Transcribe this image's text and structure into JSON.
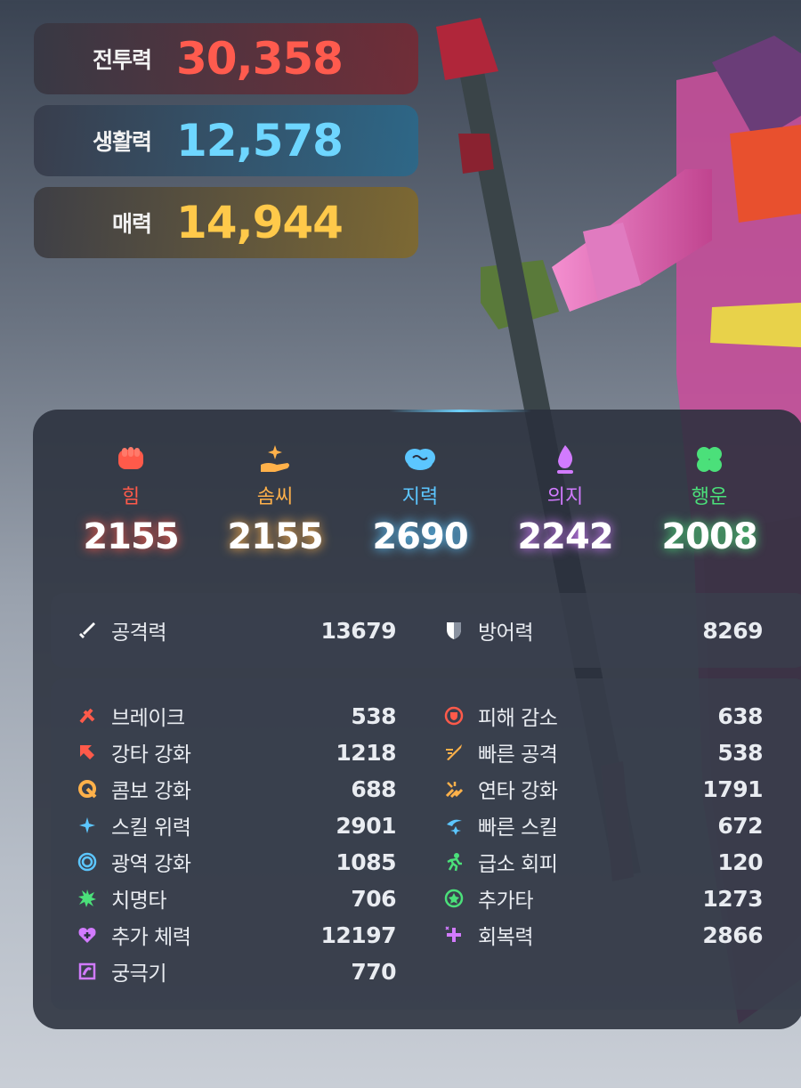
{
  "power": {
    "combat": {
      "label": "전투력",
      "value": "30,358",
      "color": "#ff5b4e"
    },
    "life": {
      "label": "생활력",
      "value": "12,578",
      "color": "#6ed6ff"
    },
    "charm": {
      "label": "매력",
      "value": "14,944",
      "color": "#ffc94a"
    }
  },
  "attributes": [
    {
      "icon": "fist-icon",
      "name": "힘",
      "value": "2155",
      "color": "#ff5a4a"
    },
    {
      "icon": "hand-sparkle-icon",
      "name": "솜씨",
      "value": "2155",
      "color": "#ffb14a"
    },
    {
      "icon": "brain-icon",
      "name": "지력",
      "value": "2690",
      "color": "#5cc6ff"
    },
    {
      "icon": "flame-icon",
      "name": "의지",
      "value": "2242",
      "color": "#d27bff"
    },
    {
      "icon": "clover-icon",
      "name": "행운",
      "value": "2008",
      "color": "#4be07a"
    }
  ],
  "main_stats": {
    "attack": {
      "icon": "sword-icon",
      "label": "공격력",
      "value": "13679"
    },
    "defense": {
      "icon": "shield-icon",
      "label": "방어력",
      "value": "8269"
    }
  },
  "sub_stats_left": [
    {
      "icon": "break-icon",
      "label": "브레이크",
      "value": "538",
      "color": "#ff5a4a"
    },
    {
      "icon": "strike-arrow-icon",
      "label": "강타 강화",
      "value": "1218",
      "color": "#ff5a4a"
    },
    {
      "icon": "combo-icon",
      "label": "콤보 강화",
      "value": "688",
      "color": "#ffb14a"
    },
    {
      "icon": "sparkle-icon",
      "label": "스킬 위력",
      "value": "2901",
      "color": "#5cc6ff"
    },
    {
      "icon": "ring-icon",
      "label": "광역 강화",
      "value": "1085",
      "color": "#5cc6ff"
    },
    {
      "icon": "burst-icon",
      "label": "치명타",
      "value": "706",
      "color": "#4be07a"
    },
    {
      "icon": "heart-plus-icon",
      "label": "추가 체력",
      "value": "12197",
      "color": "#d27bff"
    },
    {
      "icon": "ultimate-icon",
      "label": "궁극기",
      "value": "770",
      "color": "#d27bff"
    }
  ],
  "sub_stats_right": [
    {
      "icon": "damage-reduce-icon",
      "label": "피해 감소",
      "value": "638",
      "color": "#ff5a4a"
    },
    {
      "icon": "fast-attack-icon",
      "label": "빠른 공격",
      "value": "538",
      "color": "#ffb14a"
    },
    {
      "icon": "multi-hit-icon",
      "label": "연타 강화",
      "value": "1791",
      "color": "#ffb14a"
    },
    {
      "icon": "fast-skill-icon",
      "label": "빠른 스킬",
      "value": "672",
      "color": "#5cc6ff"
    },
    {
      "icon": "dodge-icon",
      "label": "급소 회피",
      "value": "120",
      "color": "#4be07a"
    },
    {
      "icon": "extra-hit-icon",
      "label": "추가타",
      "value": "1273",
      "color": "#4be07a"
    },
    {
      "icon": "recovery-icon",
      "label": "회복력",
      "value": "2866",
      "color": "#d27bff"
    }
  ]
}
